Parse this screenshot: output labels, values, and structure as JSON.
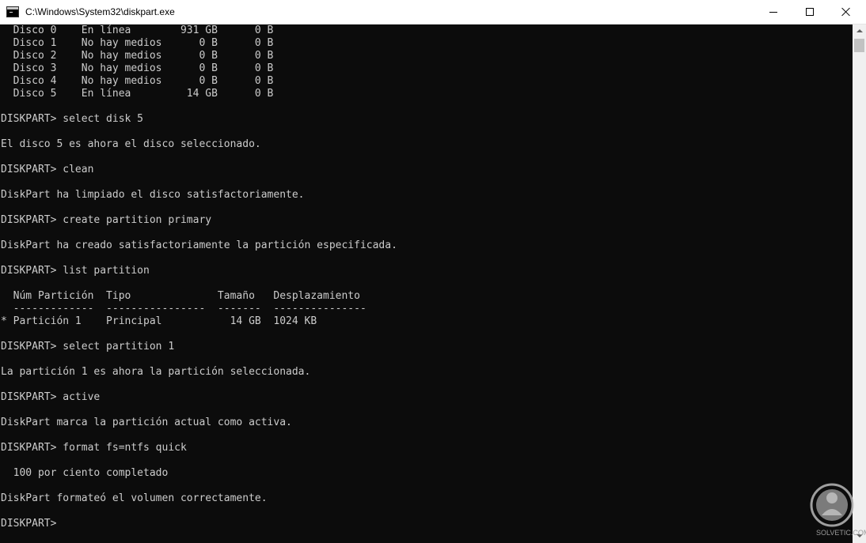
{
  "window": {
    "title": "C:\\Windows\\System32\\diskpart.exe"
  },
  "console": {
    "lines": [
      "  Disco 0    En línea        931 GB      0 B",
      "  Disco 1    No hay medios      0 B      0 B",
      "  Disco 2    No hay medios      0 B      0 B",
      "  Disco 3    No hay medios      0 B      0 B",
      "  Disco 4    No hay medios      0 B      0 B",
      "  Disco 5    En línea         14 GB      0 B",
      "",
      "DISKPART> select disk 5",
      "",
      "El disco 5 es ahora el disco seleccionado.",
      "",
      "DISKPART> clean",
      "",
      "DiskPart ha limpiado el disco satisfactoriamente.",
      "",
      "DISKPART> create partition primary",
      "",
      "DiskPart ha creado satisfactoriamente la partición especificada.",
      "",
      "DISKPART> list partition",
      "",
      "  Núm Partición  Tipo              Tamaño   Desplazamiento",
      "  -------------  ----------------  -------  ---------------",
      "* Partición 1    Principal           14 GB  1024 KB",
      "",
      "DISKPART> select partition 1",
      "",
      "La partición 1 es ahora la partición seleccionada.",
      "",
      "DISKPART> active",
      "",
      "DiskPart marca la partición actual como activa.",
      "",
      "DISKPART> format fs=ntfs quick",
      "",
      "  100 por ciento completado",
      "",
      "DiskPart formateó el volumen correctamente.",
      "",
      "DISKPART>"
    ]
  },
  "watermark": {
    "text": "SOLVETIC.COM"
  },
  "icons": {
    "app": "console-app-icon",
    "minimize": "minimize-icon",
    "maximize": "maximize-icon",
    "close": "close-icon",
    "scroll_up": "scroll-up-arrow-icon",
    "scroll_down": "scroll-down-arrow-icon",
    "watermark": "solvetic-logo-icon"
  },
  "colors": {
    "console_background": "#0c0c0c",
    "console_text": "#cccccc",
    "titlebar_background": "#ffffff",
    "scrollbar_track": "#f0f0f0",
    "scrollbar_thumb": "#c2c2c2"
  }
}
